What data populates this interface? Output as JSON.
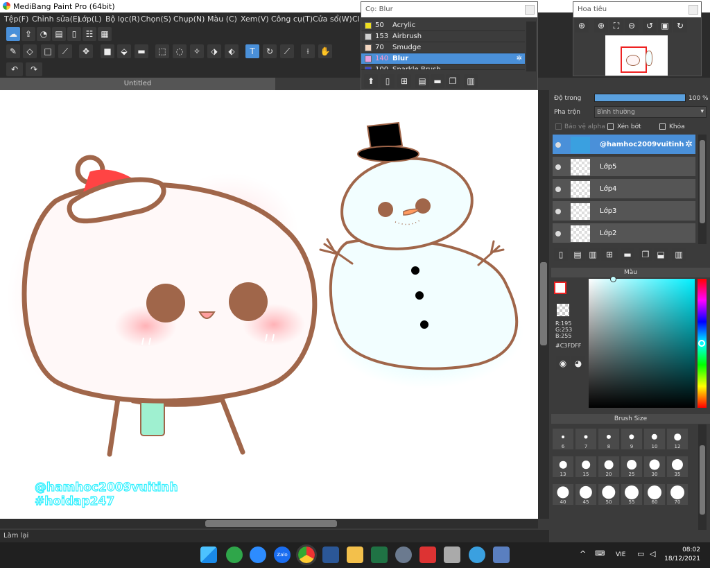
{
  "window": {
    "title": "MediBang Paint Pro (64bit)"
  },
  "menu": [
    "Tệp(F)",
    "Chỉnh sửa(E)",
    "Lớp(L)",
    "Bộ lọc(R)",
    "Chọn(S)",
    "Chụp(N)",
    "Màu (C)",
    "Xem(V)",
    "Công cụ(T)",
    "Cửa sổ(W)",
    "Cl"
  ],
  "canvas": {
    "tab_title": "Untitled",
    "watermark_line1": "@hamhoc2009vuitinh",
    "watermark_line2": "#hoidap247"
  },
  "brush_popup": {
    "title": "Cọ: Blur",
    "items": [
      {
        "size": "50",
        "name": "Acrylic",
        "color": "#f0e020"
      },
      {
        "size": "153",
        "name": "Airbrush",
        "color": "#cfcfcf"
      },
      {
        "size": "70",
        "name": "Smudge",
        "color": "#f5d7c0"
      },
      {
        "size": "140",
        "name": "Blur",
        "color": "#e8a0e0",
        "selected": true
      },
      {
        "size": "100",
        "name": "Sparkle Brush",
        "color": "#3a4ad0"
      }
    ]
  },
  "navigator": {
    "title": "Hoa tiêu"
  },
  "layer_panel": {
    "opacity_label": "Độ trong",
    "opacity_value": "100 %",
    "blend_label": "Pha trộn",
    "blend_value": "Bình thường",
    "protect_alpha": "Bảo vệ alpha",
    "clipping": "Xén bớt",
    "lock": "Khóa",
    "layers": [
      {
        "name": "@hamhoc2009vuitinh",
        "selected": true
      },
      {
        "name": "Lớp5"
      },
      {
        "name": "Lớp4"
      },
      {
        "name": "Lớp3"
      },
      {
        "name": "Lớp2"
      }
    ]
  },
  "color_panel": {
    "title": "Màu",
    "r": "R:195",
    "g": "G:253",
    "b": "B:255",
    "hex": "#C3FDFF",
    "current_color": "#C3FDFF"
  },
  "brush_size_panel": {
    "title": "Brush Size",
    "sizes": [
      "6",
      "7",
      "8",
      "9",
      "10",
      "12",
      "13",
      "15",
      "20",
      "25",
      "30",
      "35",
      "40",
      "45",
      "50",
      "55",
      "60",
      "70"
    ]
  },
  "status": {
    "text": "Làm lại"
  },
  "taskbar": {
    "lang": "VIE",
    "time": "08:02",
    "date": "18/12/2021"
  }
}
